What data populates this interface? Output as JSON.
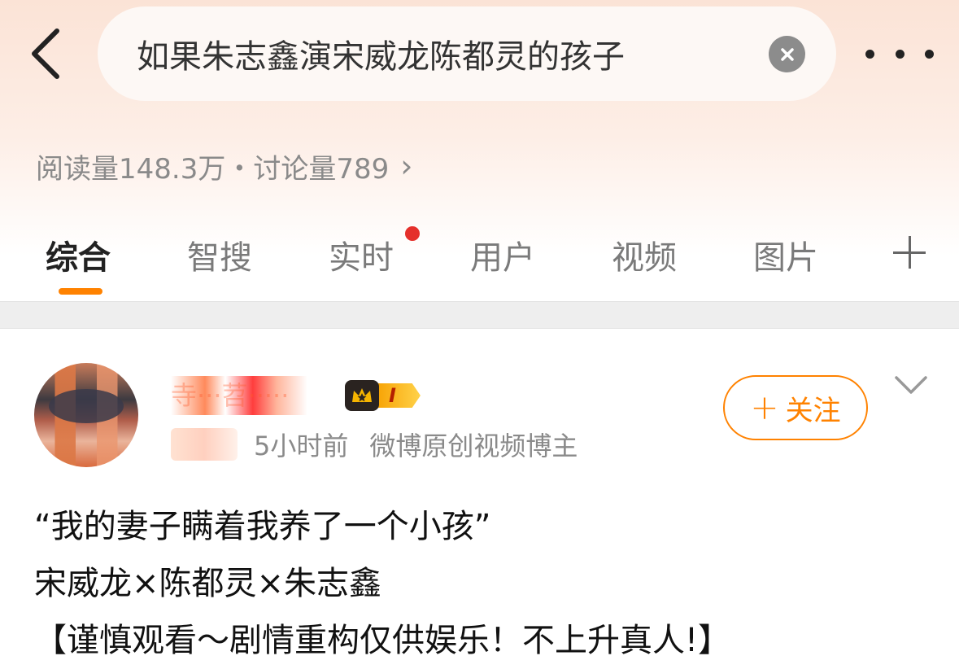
{
  "header": {
    "search_query": "如果朱志鑫演宋威龙陈都灵的孩子"
  },
  "stats": {
    "text": "阅读量148.3万・讨论量789",
    "arrow": "›"
  },
  "tabs": [
    {
      "label": "综合",
      "active": true
    },
    {
      "label": "智搜",
      "active": false
    },
    {
      "label": "实时",
      "active": false,
      "has_dot": true
    },
    {
      "label": "用户",
      "active": false
    },
    {
      "label": "视频",
      "active": false
    },
    {
      "label": "图片",
      "active": false
    }
  ],
  "post": {
    "author_name": "寺···苕·····",
    "level_badge": "I",
    "follow_label": "关注",
    "follow_plus": "+",
    "time": "5小时前",
    "author_desc": "微博原创视频博主",
    "lines": [
      "“我的妻子瞒着我养了一个小孩”",
      "宋威龙×陈都灵×朱志鑫",
      "【谨慎观看～剧情重构仅供娱乐！不上升真人!】"
    ]
  },
  "colors": {
    "accent": "#ff8200",
    "badge_red": "#e5302b",
    "header_gradient_top": "#fbe3d6"
  },
  "icons": [
    "back-arrow-icon",
    "clear-icon",
    "more-icon",
    "plus-icon",
    "chevron-down-icon",
    "crown-icon"
  ]
}
